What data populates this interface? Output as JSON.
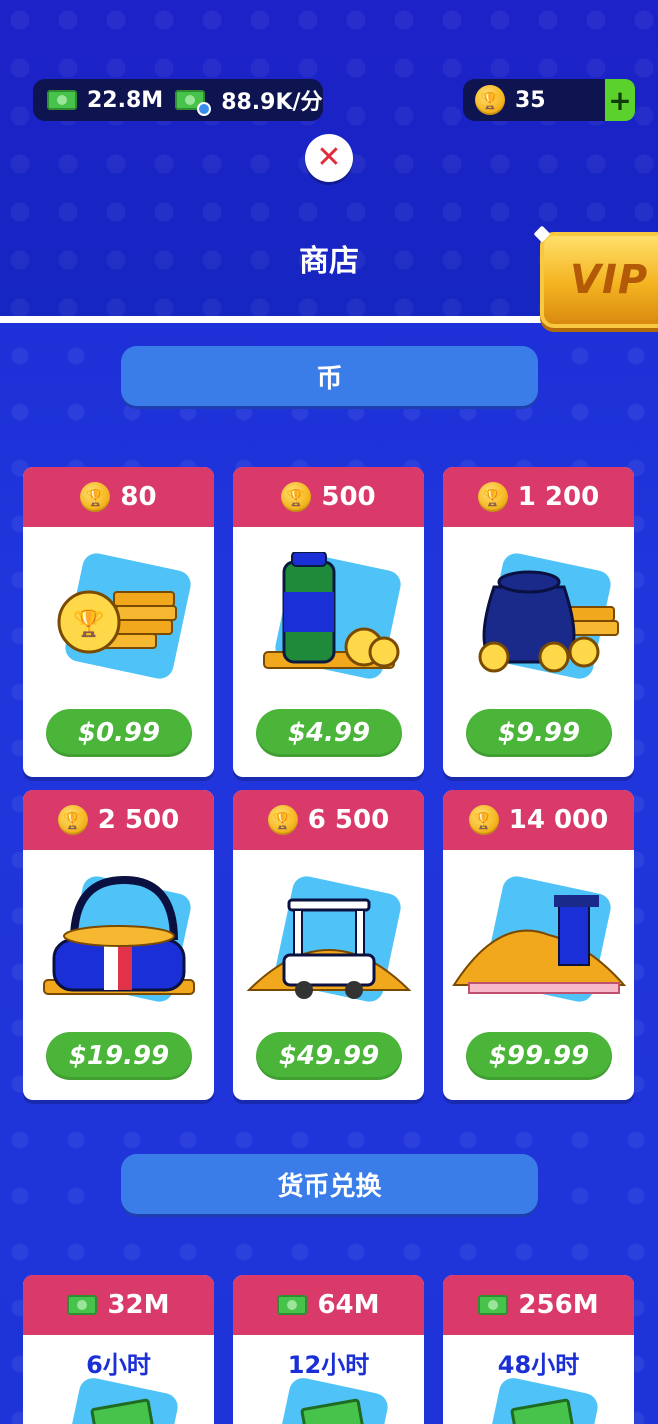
{
  "header": {
    "cash_value": "22.8M",
    "income_rate": "88.9K/分",
    "coins_value": "35",
    "title": "商店",
    "vip_label": "VIP"
  },
  "sections": {
    "coins_title": "币",
    "exchange_title": "货币兑换"
  },
  "coin_packs": [
    {
      "amount": "80",
      "price": "$0.99",
      "icon": "coin-stack-icon"
    },
    {
      "amount": "500",
      "price": "$4.99",
      "icon": "coin-bottle-icon"
    },
    {
      "amount": "1 200",
      "price": "$9.99",
      "icon": "coin-sack-icon"
    },
    {
      "amount": "2 500",
      "price": "$19.99",
      "icon": "coin-bag-icon"
    },
    {
      "amount": "6 500",
      "price": "$49.99",
      "icon": "coin-cart-icon"
    },
    {
      "amount": "14 000",
      "price": "$99.99",
      "icon": "coin-pile-icon"
    }
  ],
  "exchange_packs": [
    {
      "amount": "32M",
      "duration": "6小时"
    },
    {
      "amount": "64M",
      "duration": "12小时"
    },
    {
      "amount": "256M",
      "duration": "48小时"
    }
  ],
  "colors": {
    "background": "#1f34d8",
    "card_header": "#d93a6a",
    "price_button": "#4bb53a",
    "section_banner": "#3b7de8",
    "vip_gold": "#f4b320"
  }
}
